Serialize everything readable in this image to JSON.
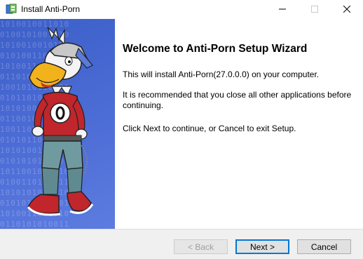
{
  "window": {
    "title": "Install Anti-Porn",
    "app_icon": "installer-icon",
    "controls": [
      "minimize-icon",
      "maximize-icon",
      "close-icon"
    ]
  },
  "sidebar": {
    "binary_text": "1010010011010\n0100101001010\n1010010010100\n0101001101001\n1010011010100\n0110101001011\n1001010110101\n0101101011010\n1010100101101\n0110010101010\n1001101010010\n0101011010101\n1010100110100\n0101010101101\n1011001010010\n0100110101011\n1010101001010\n0101010110101\n1010011001010\n0110101010011"
  },
  "main": {
    "heading": "Welcome to Anti-Porn Setup Wizard",
    "paragraphs": [
      "This will install Anti-Porn(27.0.0.0) on your computer.",
      "It is recommended that you close all other applications before continuing.",
      "Click Next to continue, or Cancel to exit Setup."
    ]
  },
  "buttons": {
    "back": "< Back",
    "next": "Next >",
    "cancel": "Cancel"
  }
}
